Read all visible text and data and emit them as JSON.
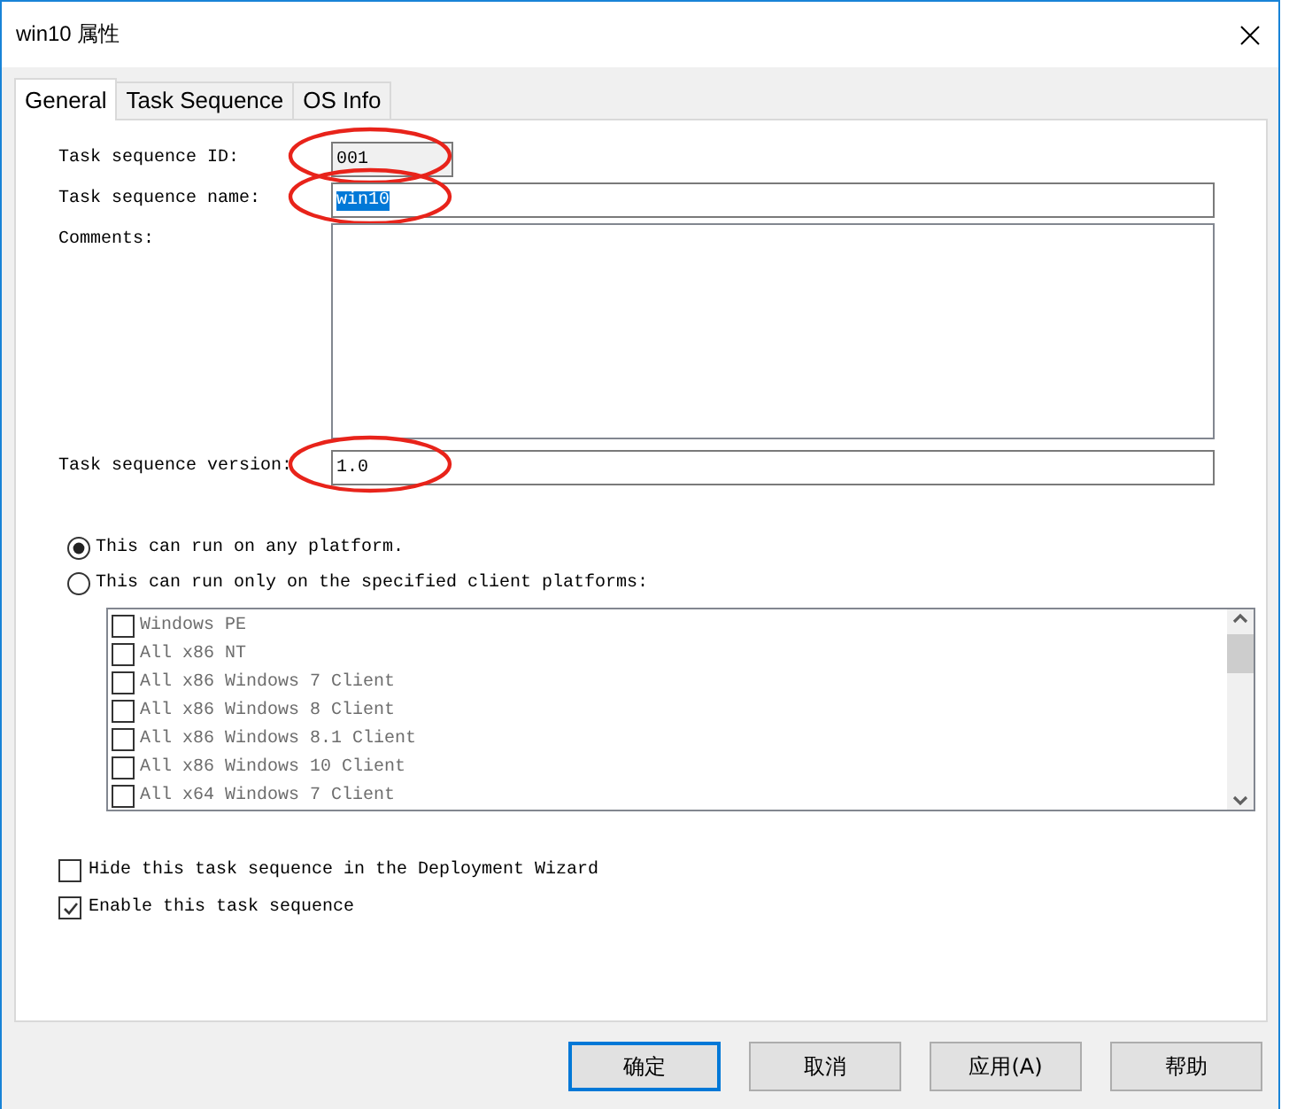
{
  "window": {
    "title": "win10 属性"
  },
  "tabs": [
    {
      "label": "General",
      "selected": true
    },
    {
      "label": "Task Sequence",
      "selected": false
    },
    {
      "label": "OS Info",
      "selected": false
    }
  ],
  "fields": [
    {
      "kind": "short",
      "label": "Task sequence ID:",
      "value": "001",
      "readonly": true,
      "highlighted": false,
      "circled": true
    },
    {
      "kind": "wide",
      "label": "Task sequence name:",
      "value": "win10",
      "readonly": false,
      "highlighted": true,
      "circled": true
    },
    {
      "kind": "multiline",
      "label": "Comments:",
      "readonly": false,
      "circled": false
    },
    {
      "kind": "wide",
      "label": "Task sequence version:",
      "value": "1.0",
      "readonly": false,
      "highlighted": false,
      "circled": true
    }
  ],
  "platform_options": [
    {
      "label": "This can run on any platform.",
      "selected": true
    },
    {
      "label": "This can run only on the specified client platforms:",
      "selected": false
    }
  ],
  "platforms": {
    "disabled": true,
    "items": [
      {
        "label": "Windows PE",
        "checked": false
      },
      {
        "label": "All x86 NT",
        "checked": false
      },
      {
        "label": "All x86 Windows 7 Client",
        "checked": false
      },
      {
        "label": "All x86 Windows 8 Client",
        "checked": false
      },
      {
        "label": "All x86 Windows 8.1 Client",
        "checked": false
      },
      {
        "label": "All x86 Windows 10 Client",
        "checked": false
      },
      {
        "label": "All x64 Windows 7 Client",
        "checked": false
      }
    ]
  },
  "options": [
    {
      "label": "Hide this task sequence in the Deployment Wizard",
      "checked": false
    },
    {
      "label": "Enable this task sequence",
      "checked": true
    }
  ],
  "buttons": [
    {
      "label": "确定",
      "default": true
    },
    {
      "label": "取消",
      "default": false
    },
    {
      "label": "应用(A)",
      "default": false
    },
    {
      "label": "帮助",
      "default": false
    }
  ]
}
